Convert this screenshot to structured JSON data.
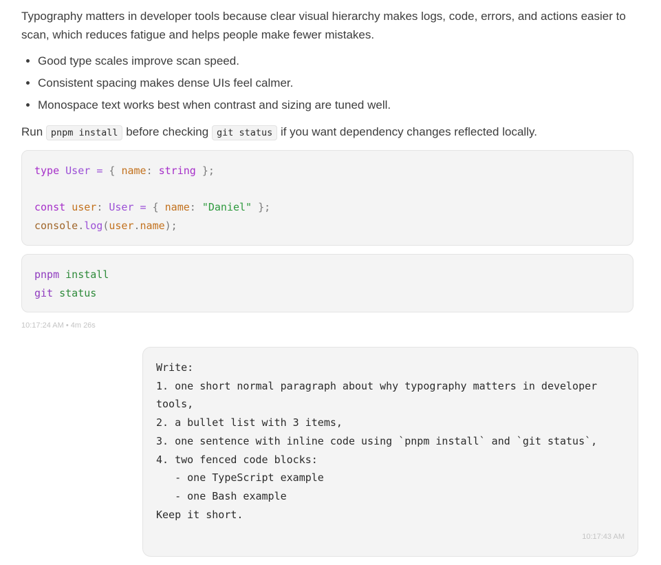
{
  "assistant_message": {
    "paragraph": "Typography matters in developer tools because clear visual hierarchy makes logs, code, errors, and actions easier to scan, which reduces fatigue and helps people make fewer mistakes.",
    "bullets": [
      "Good type scales improve scan speed.",
      "Consistent spacing makes dense UIs feel calmer.",
      "Monospace text works best when contrast and sizing are tuned well."
    ],
    "inline_sentence": {
      "part1": "Run ",
      "code1": "pnpm install",
      "part2": " before checking ",
      "code2": "git status",
      "part3": " if you want dependency changes reflected locally."
    },
    "code_typescript": {
      "line1": {
        "kw": "type",
        "type": "User",
        "eq": "=",
        "open": "{",
        "prop": "name",
        "colon": ":",
        "t": "string",
        "close": "};"
      },
      "line3": {
        "kw": "const",
        "var": "user",
        "colon": ":",
        "type": "User",
        "eq": "=",
        "open": "{",
        "prop": "name",
        "colon2": ":",
        "str": "\"Daniel\"",
        "close": "};"
      },
      "line4": {
        "obj": "console",
        "dot": ".",
        "fn": "log",
        "paren": "(",
        "arg": "user",
        "dot2": ".",
        "prop": "name",
        "end": ");"
      }
    },
    "code_bash": {
      "line1": {
        "cmd": "pnpm",
        "arg": "install"
      },
      "line2": {
        "cmd": "git",
        "arg": "status"
      }
    },
    "meta": "10:17:24 AM • 4m 26s"
  },
  "user_message": {
    "text": "Write:\n1. one short normal paragraph about why typography matters in developer\ntools,\n2. a bullet list with 3 items,\n3. one sentence with inline code using `pnpm install` and `git status`,\n4. two fenced code blocks:\n   - one TypeScript example\n   - one Bash example\nKeep it short.",
    "time": "10:17:43 AM"
  }
}
